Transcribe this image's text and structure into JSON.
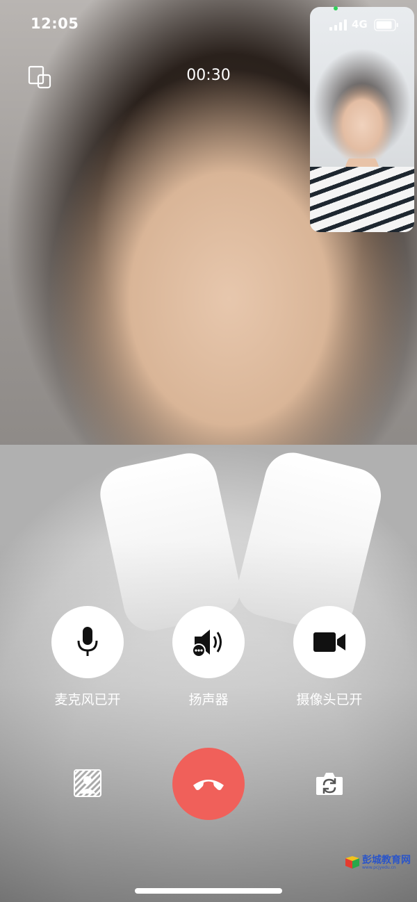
{
  "status_bar": {
    "time": "12:05",
    "network": "4G"
  },
  "call": {
    "timer": "00:30"
  },
  "controls": {
    "mic_label": "麦克风已开",
    "speaker_label": "扬声器",
    "camera_label": "摄像头已开"
  },
  "watermark": {
    "text": "彭城教育网",
    "sub": "www.pcjyedu.cn"
  },
  "colors": {
    "hangup": "#f0605a",
    "online_dot": "#2fd058"
  },
  "icons": [
    "floating-window-icon",
    "microphone-icon",
    "speaker-icon",
    "video-camera-icon",
    "blur-background-icon",
    "hangup-icon",
    "switch-camera-icon"
  ]
}
